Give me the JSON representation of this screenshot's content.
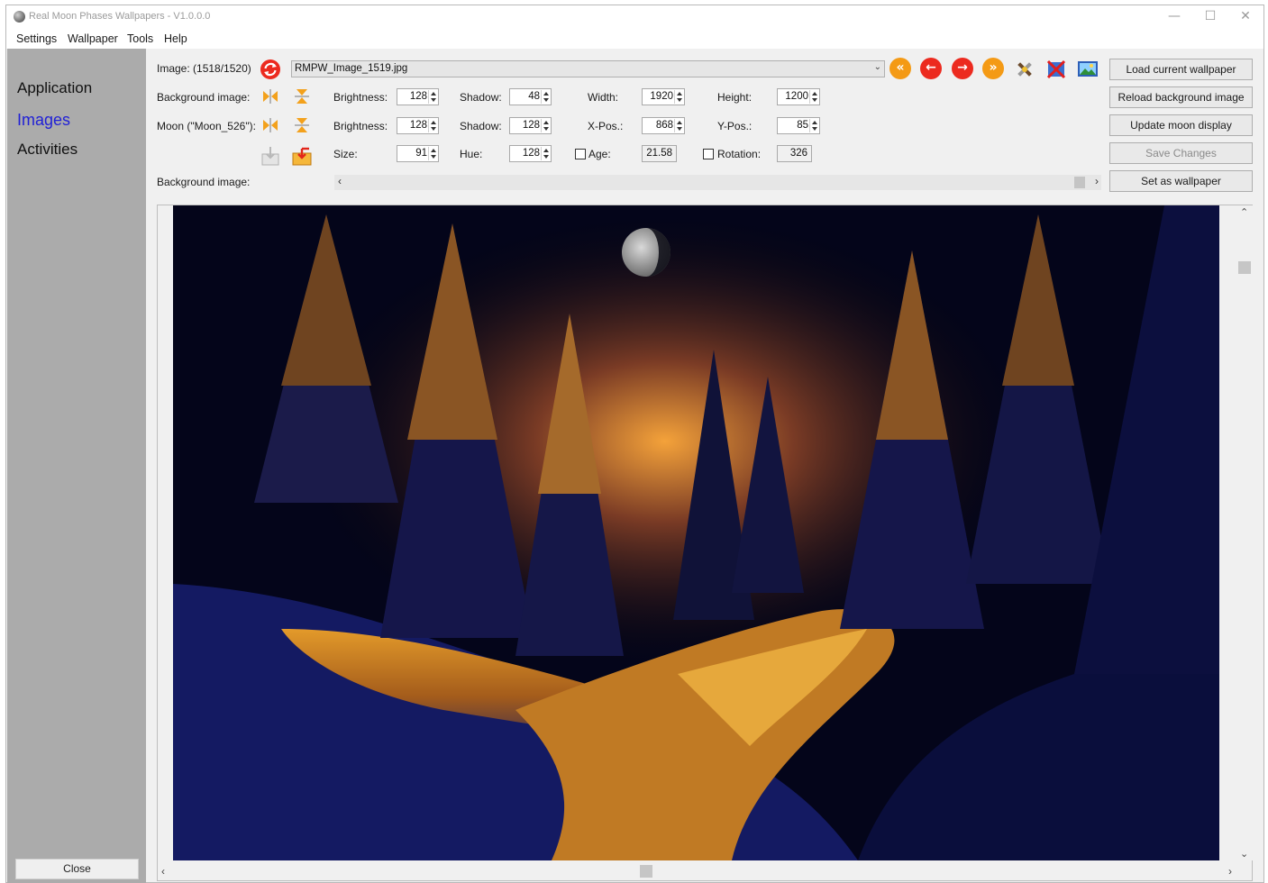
{
  "window": {
    "title": "Real Moon Phases Wallpapers - V1.0.0.0",
    "controls": {
      "minimize": "—",
      "maximize": "☐",
      "close": "✕"
    }
  },
  "menu": [
    "Settings",
    "Wallpaper",
    "Tools",
    "Help"
  ],
  "sidebar": {
    "items": [
      {
        "label": "Application",
        "active": false
      },
      {
        "label": "Images",
        "active": true
      },
      {
        "label": "Activities",
        "active": false
      }
    ],
    "close_label": "Close"
  },
  "image_row": {
    "label": "Image: (1518/1520)",
    "filename": "RMPW_Image_1519.jpg",
    "nav_icons": [
      "first-icon",
      "previous-icon",
      "next-icon",
      "last-icon"
    ]
  },
  "background_row": {
    "label": "Background image:",
    "brightness_label": "Brightness:",
    "brightness": "128",
    "shadow_label": "Shadow:",
    "shadow": "48",
    "width_label": "Width:",
    "width": "1920",
    "height_label": "Height:",
    "height": "1200"
  },
  "moon_row": {
    "label": "Moon (\"Moon_526\"):",
    "brightness_label": "Brightness:",
    "brightness": "128",
    "shadow_label": "Shadow:",
    "shadow": "128",
    "xpos_label": "X-Pos.:",
    "xpos": "868",
    "ypos_label": "Y-Pos.:",
    "ypos": "85"
  },
  "size_row": {
    "size_label": "Size:",
    "size": "91",
    "hue_label": "Hue:",
    "hue": "128",
    "age_label": "Age:",
    "age": "21.58",
    "age_checked": false,
    "rotation_label": "Rotation:",
    "rotation": "326",
    "rotation_checked": false
  },
  "bg_scroll_label": "Background image:",
  "actions": {
    "load_current": "Load current wallpaper",
    "reload_background": "Reload background image",
    "update_moon": "Update moon display",
    "save_changes": "Save Changes",
    "set_wallpaper": "Set as wallpaper"
  },
  "colors": {
    "accent_nav": "#2121d6",
    "sidebar_bg": "#ababab",
    "nav_orange": "#f49a15",
    "nav_red": "#ec2a1f"
  }
}
